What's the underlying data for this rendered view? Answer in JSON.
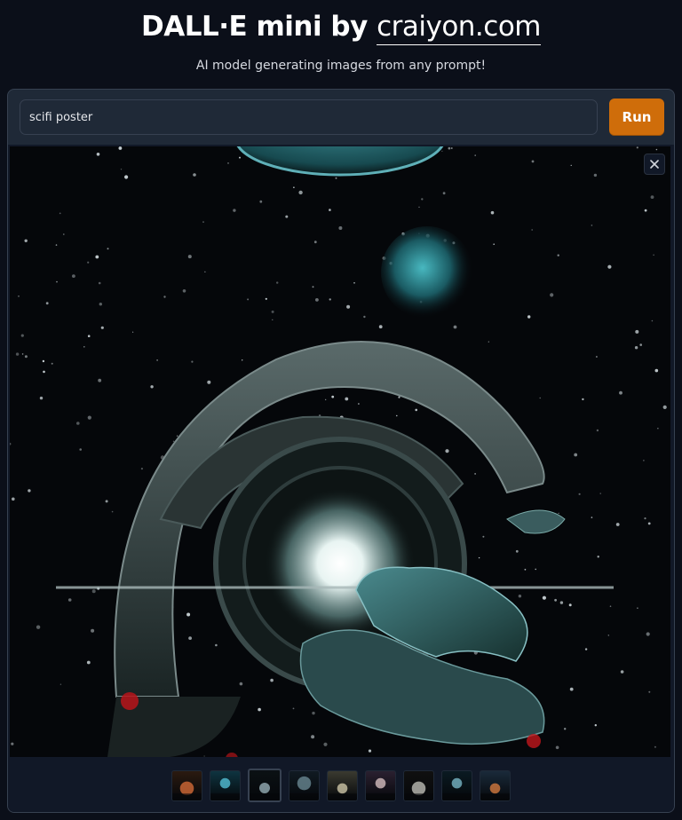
{
  "header": {
    "title_prefix": "DALL·E mini by ",
    "title_brand": "craiyon.com",
    "subtitle": "AI model generating images from any prompt!"
  },
  "prompt": {
    "value": "scifi poster",
    "placeholder": "scifi poster"
  },
  "run_button": {
    "label": "Run"
  },
  "colors": {
    "accent": "#cf6d0a",
    "background": "#0b0f19",
    "panel": "#1f2937"
  },
  "thumbnails": [
    {
      "name": "thumbnail-1",
      "selected": false,
      "bg": "#2b1a10",
      "accent": "#e0703a"
    },
    {
      "name": "thumbnail-2",
      "selected": false,
      "bg": "#0e3440",
      "accent": "#58c9e0"
    },
    {
      "name": "thumbnail-3",
      "selected": true,
      "bg": "#0b1114",
      "accent": "#9fb8c0"
    },
    {
      "name": "thumbnail-4",
      "selected": false,
      "bg": "#101a22",
      "accent": "#6f8f9a"
    },
    {
      "name": "thumbnail-5",
      "selected": false,
      "bg": "#3a3a30",
      "accent": "#d8d0b0"
    },
    {
      "name": "thumbnail-6",
      "selected": false,
      "bg": "#2a2030",
      "accent": "#e0c8c8"
    },
    {
      "name": "thumbnail-7",
      "selected": false,
      "bg": "#101010",
      "accent": "#c8c8c0"
    },
    {
      "name": "thumbnail-8",
      "selected": false,
      "bg": "#0a1a22",
      "accent": "#7fc0d0"
    },
    {
      "name": "thumbnail-9",
      "selected": false,
      "bg": "#1a2a3a",
      "accent": "#e08040"
    }
  ]
}
